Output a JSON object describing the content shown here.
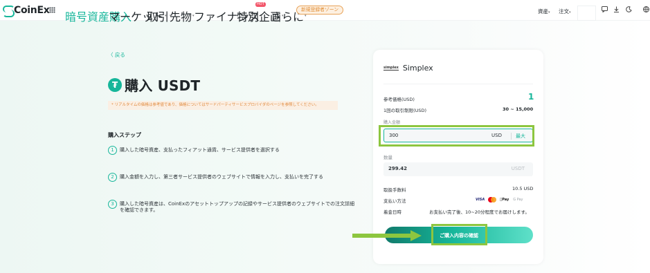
{
  "brand": {
    "name": "CoinEx",
    "accent": "#16b69a",
    "highlight": "#8dc63f"
  },
  "nav": {
    "items": [
      {
        "label": "暗号資産購入",
        "active": true
      },
      {
        "label": "マーケット"
      },
      {
        "label": "取引"
      },
      {
        "label": "先物"
      },
      {
        "label": "ファイナンス"
      },
      {
        "label": "特別企画"
      },
      {
        "label": "さらに"
      }
    ],
    "hot_badge": "HOT",
    "promo_pill": "新規登録者ゾーン",
    "right": {
      "assets": "資産",
      "orders": "注文"
    }
  },
  "page": {
    "back": "〈 戻る",
    "title": "購入 USDT",
    "notice": "* リアルタイムの価格は参考値であり、価格についてはサードパーティサービスプロバイダのページを参照してください。",
    "steps_title": "購入ステップ",
    "steps": [
      {
        "num": "1",
        "text": "購入した暗号資産、支払ったフィアット通貨、サービス提供者を選択する"
      },
      {
        "num": "2",
        "text": "購入金額を入力し、第三者サービス提供者のウェブサイトで情報を入力し、支払いを完了する"
      },
      {
        "num": "3",
        "text": "購入した暗号資産は、CoinExのアセットトップアップの記録やサービス提供者のウェブサイトでの注文詳細を確認できます。"
      }
    ]
  },
  "card": {
    "provider_logo": "simplex",
    "provider_name": "Simplex",
    "ref_price_label": "参考価格(USD)",
    "ref_price_value": "1",
    "limit_label": "1回の取引制限(USD)",
    "limit_value": "30 ~ 15,000",
    "amount_label": "購入金額",
    "amount_value": "300",
    "amount_unit": "USD",
    "amount_max": "最大",
    "qty_label": "数量",
    "qty_value": "299.42",
    "qty_unit": "USDT",
    "fee_label": "取扱手数料",
    "fee_value": "10.5 USD",
    "payment_label": "支払い方法",
    "payment_methods": [
      "VISA",
      "Mastercard",
      "Apple Pay",
      "Google Pay"
    ],
    "visa": "VISA",
    "applepay": "Pay",
    "gpay": "G Pay",
    "arrival_label": "着金日時",
    "arrival_value": "お支払い完了後、10~20分程度でお届けします。",
    "confirm_label": "ご購入内容の確認"
  }
}
